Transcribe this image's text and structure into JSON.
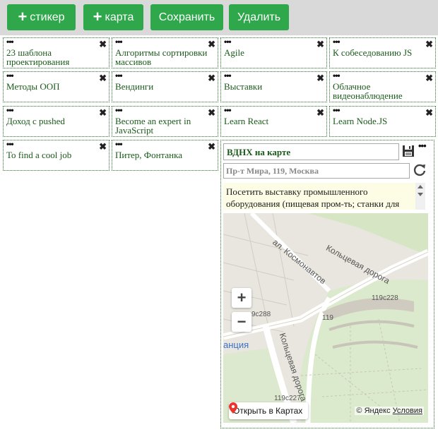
{
  "toolbar": {
    "add_sticker": "стикер",
    "add_map": "карта",
    "save": "Сохранить",
    "delete": "Удалить",
    "color": "#2ea84a"
  },
  "stickers": [
    {
      "text": "23 шаблона проектирования"
    },
    {
      "text": "Алгоритмы сортировки массивов"
    },
    {
      "text": "Agile"
    },
    {
      "text": "К собеседованию JS"
    },
    {
      "text": "Методы ООП"
    },
    {
      "text": "Вендинги"
    },
    {
      "text": "Выставки"
    },
    {
      "text": "Облачное видеонаблюдение"
    },
    {
      "text": "Доход с pushed"
    },
    {
      "text": "Become an expert in JavaScript"
    },
    {
      "text": "Learn React"
    },
    {
      "text": "Learn Node.JS"
    },
    {
      "text": "To find a cool job"
    },
    {
      "text": "Питер, Фонтанка"
    }
  ],
  "sticker_dots": "•••",
  "sticker_close": "✖",
  "map_card": {
    "title": "ВДНХ на карте",
    "address": "Пр-т Мира, 119, Москва",
    "description": "Посетить выставку промышленного оборудования (пищевая пром-ть; станки для",
    "map": {
      "open_label": "Открыть в Картах",
      "copyright": "© Яндекс",
      "terms": "Условия",
      "zoom_in": "+",
      "zoom_out": "−",
      "labels": {
        "street1": "ал. Космонавтов",
        "street2": "Кольцевая дорога",
        "street3": "Кольцевая дорога",
        "b1": "119с228",
        "b2": "9с288",
        "b3": "119",
        "b4": "119с227",
        "station": "анция"
      }
    }
  }
}
